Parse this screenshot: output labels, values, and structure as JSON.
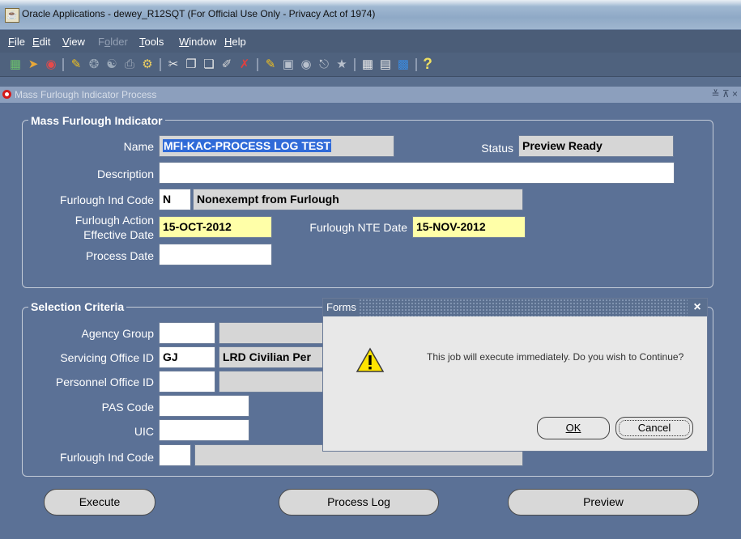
{
  "window": {
    "icon": "java-cup-icon",
    "title": "Oracle Applications - dewey_R12SQT (For Official Use Only - Privacy Act of 1974)"
  },
  "menu": {
    "items": [
      "File",
      "Edit",
      "View",
      "Folder",
      "Tools",
      "Window",
      "Help"
    ],
    "mnemonics": [
      "F",
      "E",
      "V",
      "o",
      "T",
      "W",
      "H"
    ]
  },
  "toolbar": {
    "icons": [
      "new-record-icon",
      "navigate-icon",
      "zoom-icon",
      "open-folder-icon",
      "save-icon",
      "switch-responsibility-icon",
      "print-icon",
      "find-icon",
      "cut-icon",
      "copy-icon",
      "paste-icon",
      "edit-field-icon",
      "clear-record-icon",
      "attachments-icon",
      "folder-tools-icon",
      "translations-icon",
      "attach-icon",
      "help-icon-toolbar",
      "calendar-icon",
      "calendar-alt-icon",
      "export-icon",
      "help-icon"
    ],
    "help_glyph": "?"
  },
  "form": {
    "title": "Mass Furlough Indicator Process",
    "controls": "≚ ⊼ ×"
  },
  "mfi_group": {
    "title": "Mass Furlough Indicator",
    "name_label": "Name",
    "name_value": "MFI-KAC-PROCESS LOG TEST",
    "status_label": "Status",
    "status_value": "Preview Ready",
    "description_label": "Description",
    "description_value": "",
    "furlough_ind_code_label": "Furlough Ind Code",
    "furlough_ind_code_value": "N",
    "furlough_ind_code_desc": "Nonexempt from Furlough",
    "action_date_label_1": "Furlough Action",
    "action_date_label_2": "Effective Date",
    "action_date_value": "15-OCT-2012",
    "nte_date_label": "Furlough NTE Date",
    "nte_date_value": "15-NOV-2012",
    "process_date_label": "Process Date",
    "process_date_value": ""
  },
  "selection_group": {
    "title": "Selection Criteria",
    "agency_group_label": "Agency Group",
    "servicing_office_label": "Servicing Office ID",
    "servicing_office_value": "GJ",
    "servicing_office_desc": "LRD Civilian Per",
    "personnel_office_label": "Personnel Office ID",
    "pas_code_label": "PAS Code",
    "uic_label": "UIC",
    "furlough_ind_code_label": "Furlough Ind Code"
  },
  "buttons": {
    "execute": "Execute",
    "process_log": "Process Log",
    "preview": "Preview"
  },
  "dialog": {
    "title": "Forms",
    "close": "×",
    "icon": "warning-icon",
    "message": "This job will execute immediately.  Do you wish to Continue?",
    "ok": "OK",
    "cancel": "Cancel"
  },
  "colors": {
    "background": "#5b7196",
    "field_highlight": "#ffffa8",
    "readonly_field": "#d6d6d6",
    "selected_text": "#2f6ad8"
  }
}
